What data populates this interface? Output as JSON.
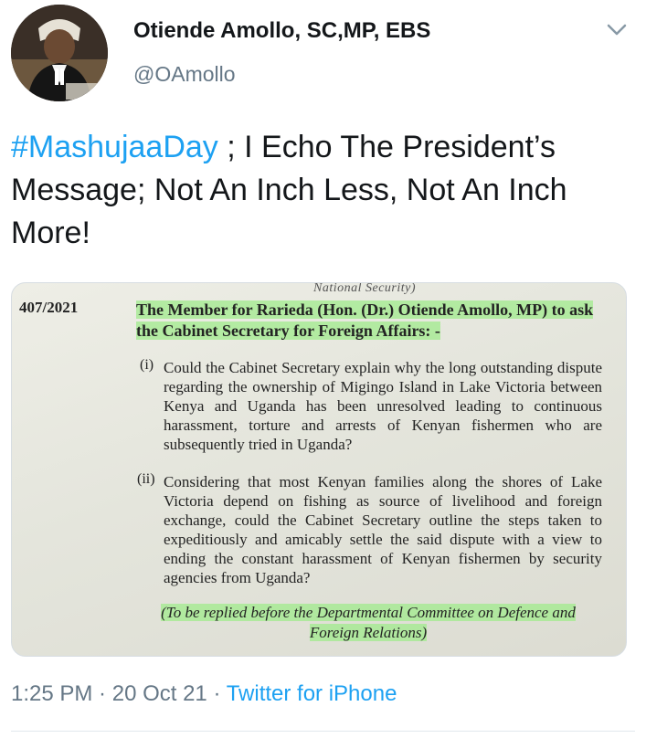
{
  "author": {
    "display_name": "Otiende Amollo, SC,MP, EBS",
    "handle": "@OAmollo",
    "avatar_icon": "profile-photo-icon"
  },
  "tweet": {
    "hashtag": "#MashujaaDay",
    "text": " ; I Echo The President’s Message; Not An Inch Less, Not An Inch More!"
  },
  "media": {
    "cutoff_text": "National Security)",
    "reference": "407/2021",
    "heading": "The Member for Rarieda (Hon. (Dr.) Otiende Amollo, MP) to ask the Cabinet Secretary for Foreign Affairs: -",
    "items": [
      {
        "num": "(i)",
        "text": "Could the Cabinet Secretary explain why the long outstanding dispute regarding the ownership of Migingo Island in Lake Victoria between Kenya and Uganda has been unresolved leading to continuous harassment, torture and arrests of Kenyan fishermen who are subsequently tried in Uganda?"
      },
      {
        "num": "(ii)",
        "text": "Considering that most Kenyan families along the shores of Lake Victoria depend on fishing as source of livelihood and foreign exchange, could the Cabinet Secretary outline the steps taken to expeditiously and amicably settle the said dispute with a view to ending the constant harassment of Kenyan fishermen by security agencies from Uganda?"
      }
    ],
    "footnote": "(To be replied before the Departmental Committee on Defence and Foreign Relations)"
  },
  "meta": {
    "time": "1:25 PM",
    "separator": " · ",
    "date": "20 Oct 21",
    "source": "Twitter for iPhone"
  },
  "colors": {
    "link": "#1da1f2",
    "secondary_text": "#657786",
    "primary_text": "#14171a",
    "highlight": "#a0eb8c"
  },
  "icons": [
    "profile-photo-icon",
    "chevron-down-icon"
  ]
}
